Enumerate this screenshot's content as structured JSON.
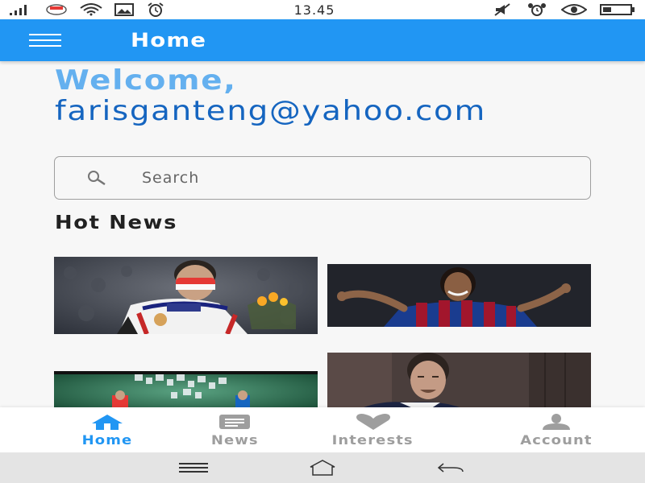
{
  "status_bar": {
    "time": "13.45",
    "icons": [
      "signal-icon",
      "flag-icon",
      "wifi-icon",
      "gallery-icon",
      "alarm-icon",
      "mute-icon",
      "alarm-clock-icon",
      "eye-icon",
      "battery-icon"
    ]
  },
  "app_bar": {
    "title": "Home",
    "menu_icon": "hamburger-menu-icon"
  },
  "welcome": {
    "label": "Welcome,",
    "email": "farisganteng@yahoo.com"
  },
  "search": {
    "placeholder": "Search",
    "value": ""
  },
  "hot_news": {
    "title": "Hot News",
    "items": [
      {
        "image": "athlete-with-medal"
      },
      {
        "image": "footballer-barcelona"
      },
      {
        "image": "tokyo-2020-badminton"
      },
      {
        "image": "chess-player"
      }
    ]
  },
  "bottom_nav": {
    "items": [
      {
        "label": "Home",
        "icon": "home-icon",
        "active": true
      },
      {
        "label": "News",
        "icon": "news-icon",
        "active": false
      },
      {
        "label": "Interests",
        "icon": "heart-icon",
        "active": false
      },
      {
        "label": "Account",
        "icon": "person-icon",
        "active": false
      }
    ]
  },
  "system_nav": {
    "icons": [
      "recents-icon",
      "home-outline-icon",
      "back-icon"
    ]
  },
  "colors": {
    "primary": "#2196f3",
    "welcome_label": "#64b0ef",
    "email": "#1565c0",
    "inactive": "#9e9e9e"
  }
}
